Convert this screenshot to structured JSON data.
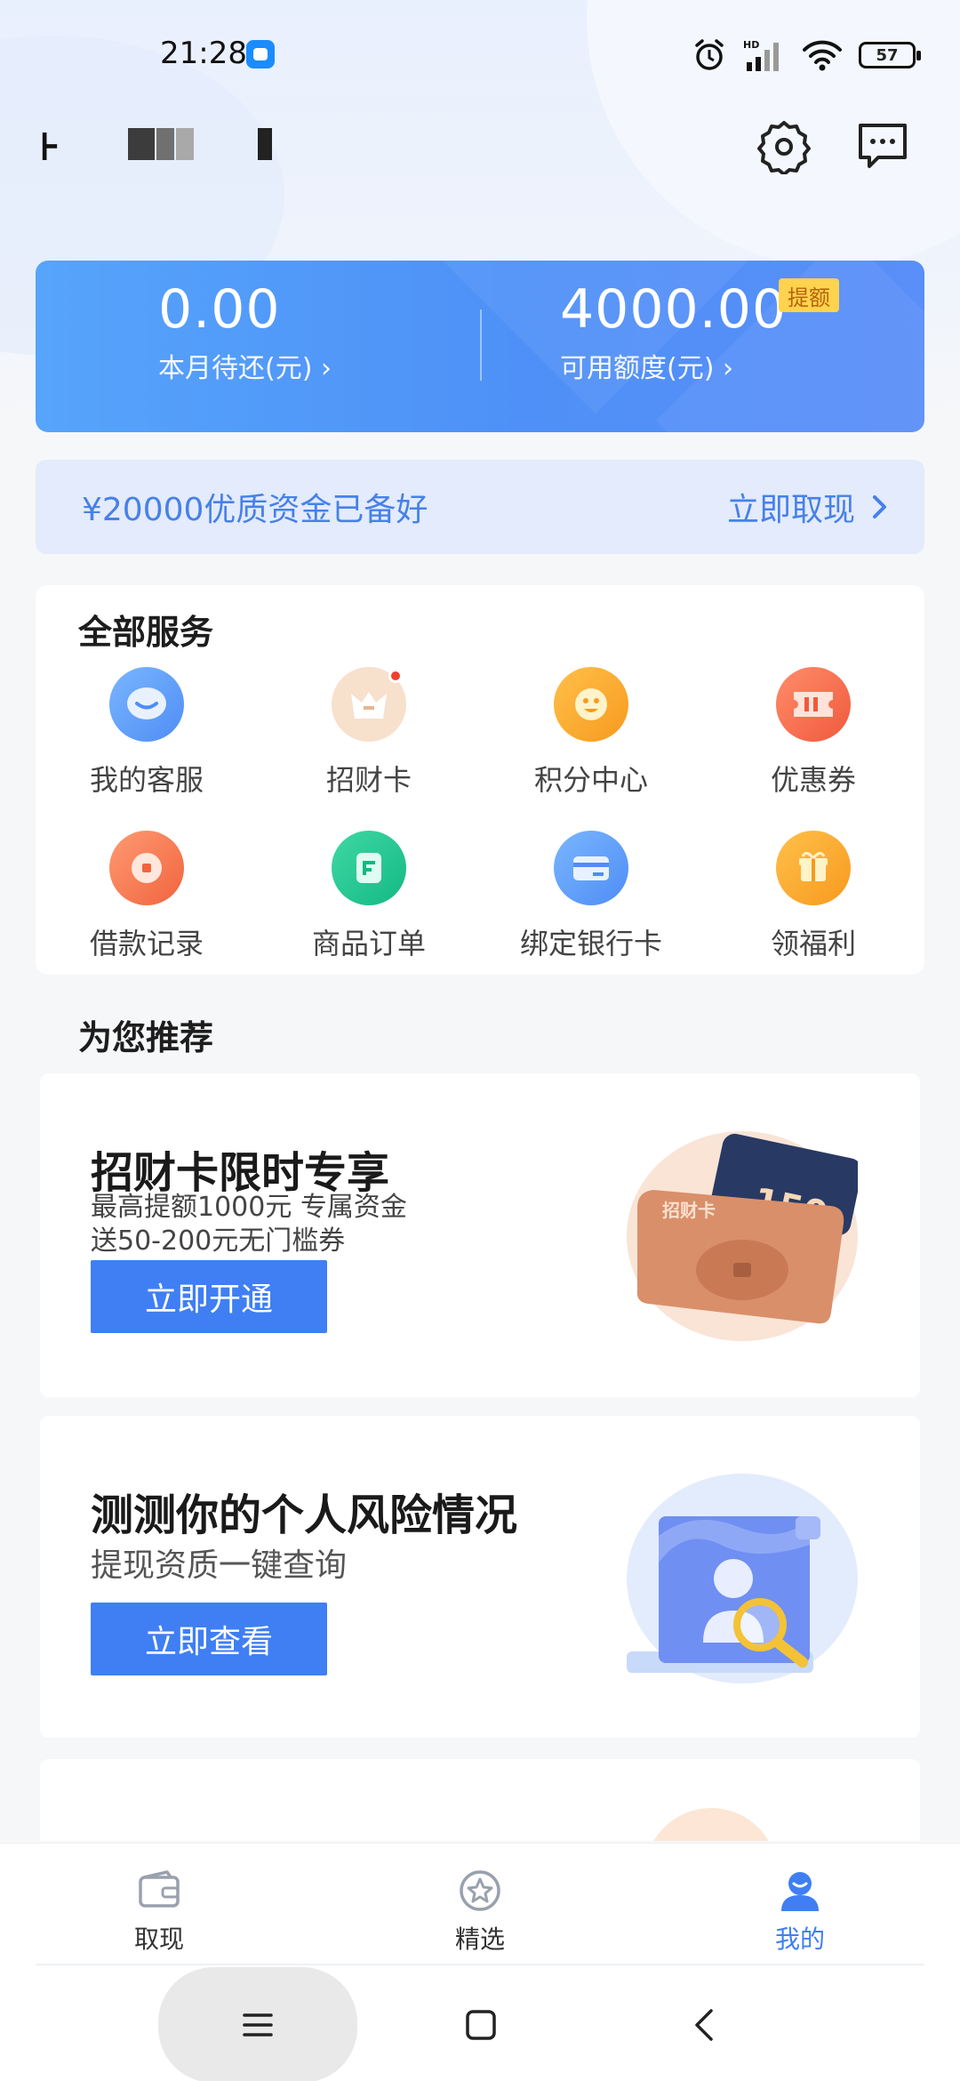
{
  "status_bar": {
    "time": "21:28",
    "battery": "57",
    "icons": [
      "app-notification-icon",
      "alarm-icon",
      "hd-signal-icon",
      "wifi-icon",
      "battery-icon"
    ]
  },
  "header": {
    "user_name": "⊦"
  },
  "summary": {
    "due_amount": "0.00",
    "due_label": "本月待还(元) ›",
    "credit_amount": "4000.00",
    "credit_label": "可用额度(元) ›",
    "raise_badge": "提额"
  },
  "promo": {
    "text": "¥20000优质资金已备好",
    "action": "立即取现"
  },
  "services": {
    "title": "全部服务",
    "items": [
      {
        "label": "我的客服"
      },
      {
        "label": "招财卡"
      },
      {
        "label": "积分中心"
      },
      {
        "label": "优惠券"
      },
      {
        "label": "借款记录"
      },
      {
        "label": "商品订单"
      },
      {
        "label": "绑定银行卡"
      },
      {
        "label": "领福利"
      }
    ]
  },
  "recommend": {
    "title": "为您推荐",
    "card1": {
      "heading": "招财卡限时专享",
      "line1": "最高提额1000元 专属资金",
      "line2": "送50-200元无门槛券",
      "button": "立即开通",
      "art_ticket": "150",
      "art_card_text": "招财卡"
    },
    "card2": {
      "heading": "测测你的个人风险情况",
      "line1": "提现资质一键查询",
      "button": "立即查看"
    }
  },
  "tabbar": {
    "tabs": [
      {
        "label": "取现"
      },
      {
        "label": "精选"
      },
      {
        "label": "我的"
      }
    ],
    "active": "我的",
    "active_color": "#3f7ff3"
  }
}
